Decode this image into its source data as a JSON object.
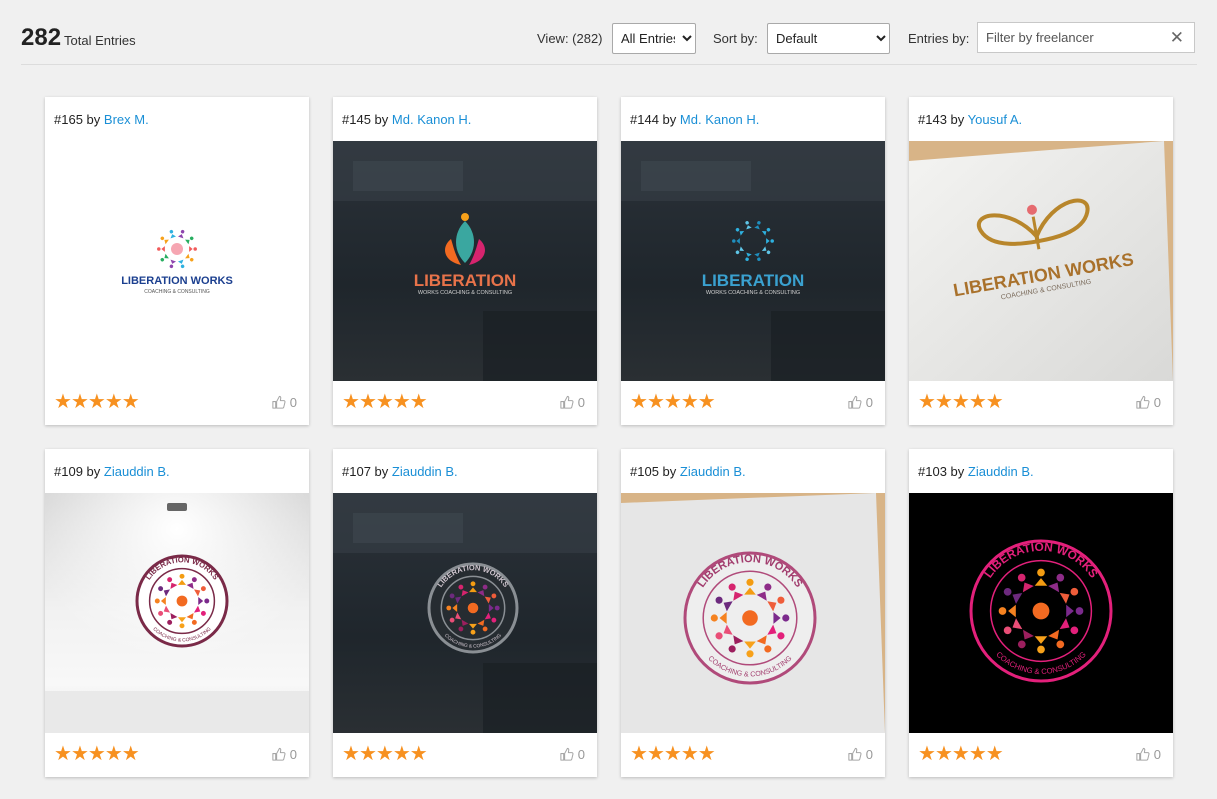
{
  "summary": {
    "total": "282",
    "total_label": "Total Entries"
  },
  "controls": {
    "view_label": "View: (282)",
    "view_value": "All Entries",
    "sort_label": "Sort by:",
    "sort_value": "Default",
    "entries_label": "Entries by:",
    "filter_placeholder": "Filter by freelancer"
  },
  "cards": [
    {
      "num": "#165",
      "by": "by",
      "author": "Brex M.",
      "likes": "0",
      "rating": 5,
      "thumb": "white-figures"
    },
    {
      "num": "#145",
      "by": "by",
      "author": "Md. Kanon H.",
      "likes": "0",
      "rating": 5,
      "thumb": "dark-lotus"
    },
    {
      "num": "#144",
      "by": "by",
      "author": "Md. Kanon H.",
      "likes": "0",
      "rating": 5,
      "thumb": "dark-ring"
    },
    {
      "num": "#143",
      "by": "by",
      "author": "Yousuf A.",
      "likes": "0",
      "rating": 5,
      "thumb": "paper-butterfly"
    },
    {
      "num": "#109",
      "by": "by",
      "author": "Ziauddin B.",
      "likes": "0",
      "rating": 5,
      "thumb": "wall-spotlight"
    },
    {
      "num": "#107",
      "by": "by",
      "author": "Ziauddin B.",
      "likes": "0",
      "rating": 5,
      "thumb": "dark-emblem"
    },
    {
      "num": "#105",
      "by": "by",
      "author": "Ziauddin B.",
      "likes": "0",
      "rating": 5,
      "thumb": "paper-emboss"
    },
    {
      "num": "#103",
      "by": "by",
      "author": "Ziauddin B.",
      "likes": "0",
      "rating": 5,
      "thumb": "black-emblem"
    }
  ],
  "logo_text": {
    "brand": "LIBERATION WORKS",
    "brand_short": "LIBERATION",
    "tagline": "COACHING & CONSULTING",
    "tagline_alt": "WORKS COACHING & CONSULTING"
  },
  "colors": {
    "link": "#1a8fd6",
    "star": "#f79120",
    "brand_blue": "#1b3f8f",
    "brand_magenta": "#c2185b",
    "brand_gold": "#b8862b"
  }
}
